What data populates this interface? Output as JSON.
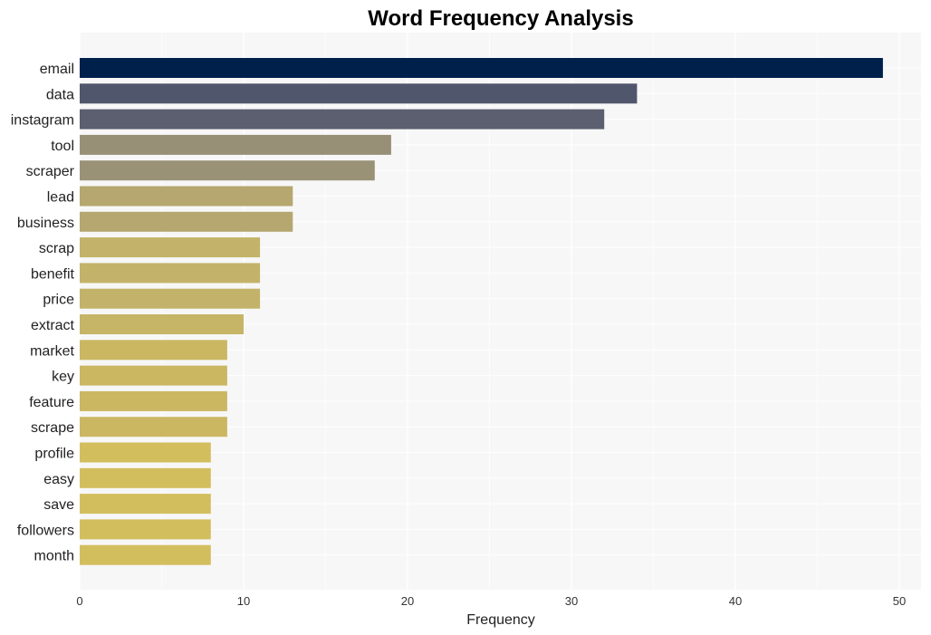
{
  "chart_data": {
    "type": "bar",
    "orientation": "horizontal",
    "title": "Word Frequency Analysis",
    "xlabel": "Frequency",
    "ylabel": "",
    "xlim": [
      0,
      51.5
    ],
    "xticks": [
      0,
      10,
      20,
      30,
      40,
      50
    ],
    "grid": true,
    "categories": [
      "email",
      "data",
      "instagram",
      "tool",
      "scraper",
      "lead",
      "business",
      "scrap",
      "benefit",
      "price",
      "extract",
      "market",
      "key",
      "feature",
      "scrape",
      "profile",
      "easy",
      "save",
      "followers",
      "month"
    ],
    "values": [
      49,
      34,
      32,
      19,
      18,
      13,
      13,
      11,
      11,
      11,
      10,
      9,
      9,
      9,
      9,
      8,
      8,
      8,
      8,
      8
    ],
    "colors": [
      "#00204c",
      "#50566b",
      "#5b5f6f",
      "#979077",
      "#9a9277",
      "#b5a76f",
      "#b5a76f",
      "#c3b26a",
      "#c3b26a",
      "#c3b26a",
      "#c6b467",
      "#cbb762",
      "#cbb762",
      "#cbb762",
      "#cbb762",
      "#d3be5d",
      "#d3be5d",
      "#d3be5d",
      "#d3be5d",
      "#d3be5d"
    ]
  },
  "style": {
    "plot_background": "#f7f7f7",
    "grid_color": "#ffffff"
  }
}
